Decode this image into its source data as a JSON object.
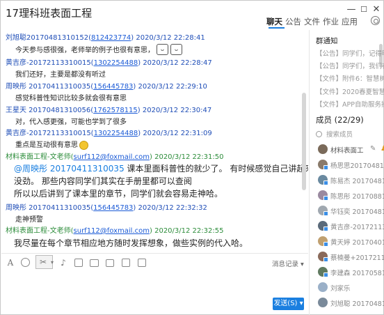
{
  "window": {
    "title": "17理科班表面工程",
    "min_glyph": "—",
    "max_glyph": "☐",
    "close_glyph": "✕"
  },
  "tabs": [
    {
      "label": "聊天",
      "active": true
    },
    {
      "label": "公告"
    },
    {
      "label": "文件"
    },
    {
      "label": "作业"
    },
    {
      "label": "应用"
    }
  ],
  "messages": [
    {
      "sender": "刘旭聪",
      "sender_id": "20170481310152(",
      "qq": "812423774",
      "close": ")",
      "time": "2020/3/12 22:28:41",
      "text": "今天参与感很强，老师举的例子也很有意思，",
      "emoji": [
        "ᴗ",
        "ᴗ"
      ]
    },
    {
      "sender": "黄吉彦",
      "sender_id": "-20172113310015(",
      "qq": "1302254488",
      "close": ")",
      "time": "2020/3/12 22:28:47",
      "text": "我们还好，主要是都没有听过"
    },
    {
      "sender": "周映彤",
      "sender_id": " 20170411310035(",
      "qq": "156445783",
      "close": ")",
      "time": "2020/3/12 22:29:10",
      "text": "感觉科普性知识比较多就会很有意思"
    },
    {
      "sender": "王星天",
      "sender_id": " 20170481310056(",
      "qq": "1762578115",
      "close": ")",
      "time": "2020/3/12 22:30:47",
      "text": "对，代入感更强，可能也学到了很多"
    },
    {
      "sender": "黄吉彦",
      "sender_id": "-20172113310015(",
      "qq": "1302254488",
      "close": ")",
      "time": "2020/3/12 22:31:09",
      "text": "重点是互动很有意思"
    },
    {
      "sender": "材料表面工程-文老师",
      "sender_id": "(",
      "qq": "surf112@foxmail.com",
      "close": ")",
      "time": "2020/3/12 22:31:50",
      "teacher": true,
      "lines": [
        "@周映彤 20170411310035  课本里面科普性的就少了。 有时候感觉自己讲起来都",
        "没劲。 那些内容同学们其实在手册里都可以查阅",
        "所以以后讲到了课本里的章节，同学们就会容易走神哈。"
      ]
    },
    {
      "sender": "周映彤",
      "sender_id": " 20170411310035(",
      "qq": "156445783",
      "close": ")",
      "time": "2020/3/12 22:32:32",
      "text": "走神预警"
    },
    {
      "sender": "材料表面工程-文老师",
      "sender_id": "(",
      "qq": "surf112@foxmail.com",
      "close": ")",
      "time": "2020/3/12 22:32:55",
      "teacher": true,
      "lines": [
        "我尽量在每个章节相应地方随时发挥想象，做些实例的代入哈。"
      ]
    }
  ],
  "mention": "@周映彤 20170411310035",
  "toolbar": {
    "history_label": "消息记录 ▾"
  },
  "send_label": "发送(S) ▾",
  "right_panel": {
    "notice_title": "群通知",
    "notices": [
      "【公告】同学们，记得明…",
      "【公告】同学们，我们在…",
      "【文件】附件6：智慧树…",
      "【文件】2020春夏智慧树…",
      "【文件】APP自助服务操…"
    ],
    "members_title": "成员 (22/29)",
    "search_placeholder": "搜索成员",
    "members": [
      {
        "name": "材料表面工",
        "color": "#7a6a5a",
        "owner": true
      },
      {
        "name": "杨思思2017048131",
        "color": "#8a7a6a"
      },
      {
        "name": "陈易杰 2017048131",
        "color": "#6a8aa0"
      },
      {
        "name": "陈思彤 2017088131",
        "color": "#9a8aa0"
      },
      {
        "name": "华钰奕 2017048131",
        "color": "#a0a8b0"
      },
      {
        "name": "黄吉彦-2017211331",
        "color": "#5a6a7a"
      },
      {
        "name": "黄天婷 2017040131",
        "color": "#c0a070"
      },
      {
        "name": "蔡楠曼+2017211331",
        "color": "#8a6a5a"
      },
      {
        "name": "李建森 2017058131",
        "color": "#607a60"
      },
      {
        "name": "刘家乐",
        "color": "#9ab0c8"
      },
      {
        "name": "刘旭聪 2017048131",
        "color": "#7a8a9a"
      }
    ]
  },
  "colors": {
    "accent": "#1a7fe0",
    "sender_blue": "#1e4db7",
    "teacher_green": "#2c8c3a"
  }
}
